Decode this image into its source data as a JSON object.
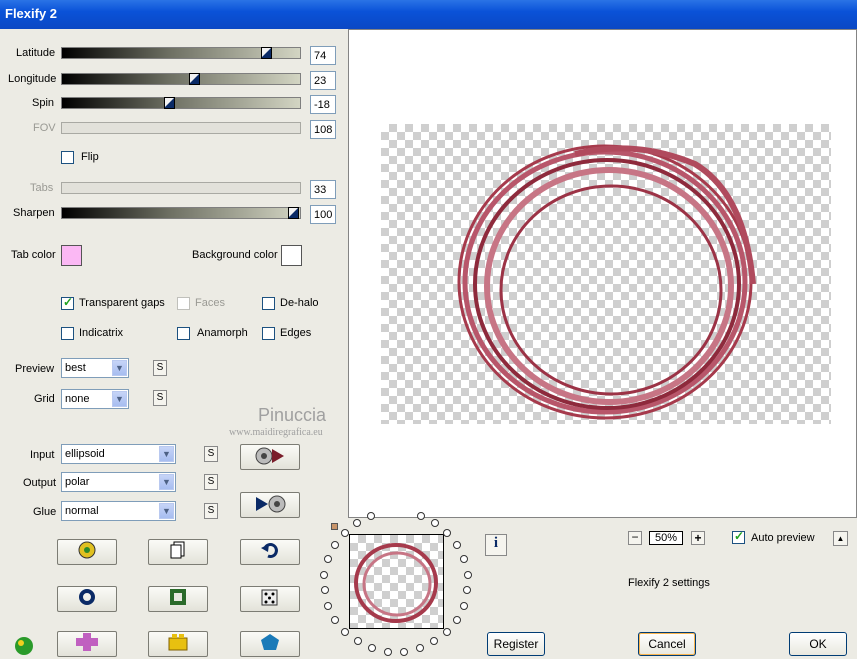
{
  "window": {
    "title": "Flexify 2"
  },
  "params": {
    "latitude": {
      "label": "Latitude",
      "value": "74",
      "fraction": 0.88
    },
    "longitude": {
      "label": "Longitude",
      "value": "23",
      "fraction": 0.56
    },
    "spin": {
      "label": "Spin",
      "value": "-18",
      "fraction": 0.45
    },
    "fov": {
      "label": "FOV",
      "value": "108"
    },
    "flip": {
      "label": "Flip",
      "checked": false
    },
    "tabs": {
      "label": "Tabs",
      "value": "33"
    },
    "sharpen": {
      "label": "Sharpen",
      "value": "100",
      "fraction": 1.0
    }
  },
  "colors": {
    "tab_color_label": "Tab color",
    "tab_color": "#fbb8f4",
    "background_color_label": "Background color",
    "background_color": "#ffffff",
    "ring_color": "#a63a4c"
  },
  "options": {
    "transparent_gaps": "Transparent gaps",
    "faces": "Faces",
    "de_halo": "De-halo",
    "indicatrix": "Indicatrix",
    "anamorph": "Anamorph",
    "edges": "Edges"
  },
  "preview": {
    "label": "Preview",
    "value": "best"
  },
  "grid": {
    "label": "Grid",
    "value": "none"
  },
  "input": {
    "label": "Input",
    "value": "ellipsoid"
  },
  "output": {
    "label": "Output",
    "value": "polar"
  },
  "glue": {
    "label": "Glue",
    "value": "normal"
  },
  "small_button": "S",
  "watermark": {
    "name": "Pinuccia",
    "url": "www.maidiregrafica.eu"
  },
  "zoom": {
    "minus": "−",
    "value": "50%",
    "plus": "+"
  },
  "auto_preview": {
    "label": "Auto preview",
    "checked": true
  },
  "settings_text": "Flexify 2 settings",
  "buttons": {
    "register": "Register",
    "cancel": "Cancel",
    "ok": "OK",
    "info": "i",
    "up": "▲"
  }
}
